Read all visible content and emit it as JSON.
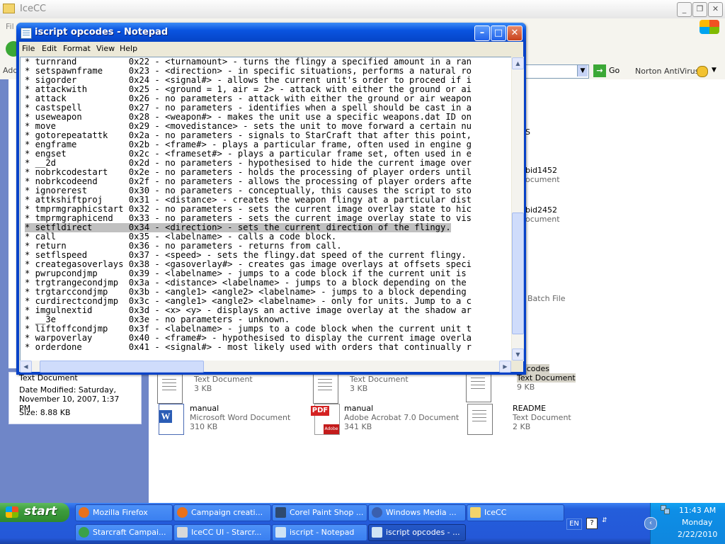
{
  "explorer": {
    "title": "IceCC",
    "menu_first": "Fil",
    "go_label": "Go",
    "address_prefix": "Add",
    "norton_label": "Norton AntiVirus",
    "details": {
      "type": "Text Document",
      "modified": "Date Modified: Saturday, November 10, 2007, 1:37 PM",
      "size": "Size: 8.88 KB"
    },
    "partial_labels": [
      "S",
      "bid1452",
      "ocument",
      "bid2452",
      "ocument",
      "Batch File"
    ],
    "files_row1": [
      {
        "type": "Text Document",
        "size": "3 KB"
      },
      {
        "type": "Text Document",
        "size": "3 KB"
      },
      {
        "name": "opcodes",
        "type": "Text Document",
        "size": "9 KB"
      }
    ],
    "files_row2": [
      {
        "name": "manual",
        "type": "Microsoft Word Document",
        "size": "310 KB",
        "icon": "word-doc-icon"
      },
      {
        "name": "manual",
        "type": "Adobe Acrobat 7.0 Document",
        "size": "341 KB",
        "icon": "pdf-doc-icon"
      },
      {
        "name": "README",
        "type": "Text Document",
        "size": "2 KB",
        "icon": "text-doc-icon"
      }
    ]
  },
  "notepad": {
    "title": "iscript opcodes - Notepad",
    "menu": [
      "File",
      "Edit",
      "Format",
      "View",
      "Help"
    ],
    "lines": [
      "* turnrand          0x22 - <turnamount> - turns the flingy a specified amount in a ran",
      "* setspawnframe     0x23 - <direction> - in specific situations, performs a natural ro",
      "* sigorder          0x24 - <signal#> - allows the current unit's order to proceed if i",
      "* attackwith        0x25 - <ground = 1, air = 2> - attack with either the ground or ai",
      "* attack            0x26 - no parameters - attack with either the ground or air weapon",
      "* castspell         0x27 - no parameters - identifies when a spell should be cast in a",
      "* useweapon         0x28 - <weapon#> - makes the unit use a specific weapons.dat ID on",
      "* move              0x29 - <movedistance> - sets the unit to move forward a certain nu",
      "* gotorepeatattk    0x2a - no parameters - signals to StarCraft that after this point,",
      "* engframe          0x2b - <frame#> - plays a particular frame, often used in engine g",
      "* engset            0x2c - <frameset#> - plays a particular frame set, often used in e",
      "* __2d              0x2d - no parameters - hypothesised to hide the current image over",
      "* nobrkcodestart    0x2e - no parameters - holds the processing of player orders until",
      "* nobrkcodeend      0x2f - no parameters - allows the processing of player orders afte",
      "* ignorerest        0x30 - no parameters - conceptually, this causes the script to sto",
      "* attkshiftproj     0x31 - <distance> - creates the weapon flingy at a particular dist",
      "* tmprmgraphicstart 0x32 - no parameters - sets the current image overlay state to hic",
      "* tmprmgraphicend   0x33 - no parameters - sets the current image overlay state to vis",
      "* setfldirect       0x34 - <direction> - sets the current direction of the flingy.",
      "* call              0x35 - <labelname> - calls a code block.",
      "* return            0x36 - no parameters - returns from call.",
      "* setflspeed        0x37 - <speed> - sets the flingy.dat speed of the current flingy.",
      "* creategasoverlays 0x38 - <gasoverlay#> - creates gas image overlays at offsets speci",
      "* pwrupcondjmp      0x39 - <labelname> - jumps to a code block if the current unit is",
      "* trgtrangecondjmp  0x3a - <distance> <labelname> - jumps to a block depending on the",
      "* trgtarccondjmp    0x3b - <angle1> <angle2> <labelname> - jumps to a block depending",
      "* curdirectcondjmp  0x3c - <angle1> <angle2> <labelname> - only for units. Jump to a c",
      "* imgulnextid       0x3d - <x> <y> - displays an active image overlay at the shadow ar",
      "* __3e              0x3e - no parameters - unknown.",
      "* liftoffcondjmp    0x3f - <labelname> - jumps to a code block when the current unit t",
      "* warpoverlay       0x40 - <frame#> - hypothesised to display the current image overla",
      "* orderdone         0x41 - <signal#> - most likely used with orders that continually r"
    ],
    "highlighted_line": 18
  },
  "taskbar": {
    "start": "start",
    "row1": [
      {
        "label": "Mozilla Firefox",
        "icon": "firefox-icon"
      },
      {
        "label": "Campaign creati...",
        "icon": "firefox-icon"
      },
      {
        "label": "Corel Paint Shop ...",
        "icon": "paintshop-icon"
      },
      {
        "label": "Windows Media ...",
        "icon": "media-player-icon"
      },
      {
        "label": "IceCC",
        "icon": "folder-icon"
      }
    ],
    "row2": [
      {
        "label": "Starcraft Campai...",
        "icon": "globe-icon"
      },
      {
        "label": "IceCC UI - Starcr...",
        "icon": "java-icon"
      },
      {
        "label": "iscript - Notepad",
        "icon": "notepad-icon"
      },
      {
        "label": "iscript opcodes - ...",
        "icon": "notepad-icon",
        "active": true
      }
    ],
    "lang": "EN",
    "time": "11:43 AM",
    "day": "Monday",
    "date": "2/22/2010"
  }
}
